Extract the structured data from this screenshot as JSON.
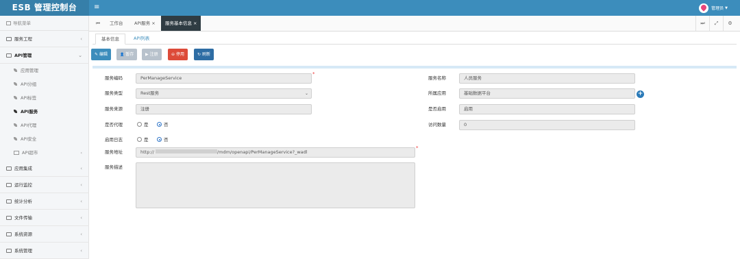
{
  "app": {
    "title": "ESB 管理控制台",
    "menu_toggle": "≡"
  },
  "user": {
    "name": "管理员",
    "caret": "▼"
  },
  "sidebar": {
    "header": "导航菜单",
    "items": [
      {
        "label": "服务工程",
        "chev": "‹"
      },
      {
        "label": "API管理",
        "chev": "⌄"
      },
      {
        "label": "应用集成",
        "chev": "‹"
      },
      {
        "label": "运行监控",
        "chev": "‹"
      },
      {
        "label": "统计分析",
        "chev": "‹"
      },
      {
        "label": "文件传输",
        "chev": "‹"
      },
      {
        "label": "系统资源",
        "chev": "‹"
      },
      {
        "label": "系统管理",
        "chev": "‹"
      }
    ],
    "sub_items": [
      {
        "label": "应用管理"
      },
      {
        "label": "API分组"
      },
      {
        "label": "API标签"
      },
      {
        "label": "API服务"
      },
      {
        "label": "API代理"
      },
      {
        "label": "API安全"
      },
      {
        "label": "API超市",
        "chev": "‹"
      }
    ]
  },
  "tabs": {
    "back": "⏮",
    "items": [
      {
        "label": "工作台"
      },
      {
        "label": "API服务",
        "close": "×"
      },
      {
        "label": "服务基本信息",
        "close": "×"
      }
    ],
    "controls": [
      "⏭",
      "⤢",
      "⚙"
    ]
  },
  "subtabs": [
    "基本信息",
    "API列表"
  ],
  "toolbar": [
    {
      "label": "编辑",
      "icon": "✎",
      "color": "#3c8dbc"
    },
    {
      "label": "暂存",
      "icon": "👤",
      "color": "#b8c2cc"
    },
    {
      "label": "注册",
      "icon": "▶",
      "color": "#b8c2cc"
    },
    {
      "label": "停用",
      "icon": "⊖",
      "color": "#dd4b39"
    },
    {
      "label": "刷新",
      "icon": "↻",
      "color": "#2e6da4"
    }
  ],
  "form": {
    "service_code": {
      "label": "服务编码",
      "value": "PerManageService"
    },
    "service_name": {
      "label": "服务名称",
      "value": "人员服务"
    },
    "service_type": {
      "label": "服务类型",
      "value": "Rest服务"
    },
    "app": {
      "label": "所属应用",
      "value": "基础数据平台"
    },
    "source": {
      "label": "服务来源",
      "value": "注册"
    },
    "enabled": {
      "label": "是否启用",
      "value": "启用"
    },
    "proxy": {
      "label": "是否代理",
      "yes": "是",
      "no": "否"
    },
    "access_count": {
      "label": "访问数量",
      "value": "0"
    },
    "log": {
      "label": "启用日志",
      "yes": "是",
      "no": "否"
    },
    "address": {
      "label": "服务地址",
      "prefix": "http://",
      "suffix": "/mdm/openapi/PerManageService?_wadl"
    },
    "desc": {
      "label": "服务描述"
    },
    "required_mark": "*"
  }
}
